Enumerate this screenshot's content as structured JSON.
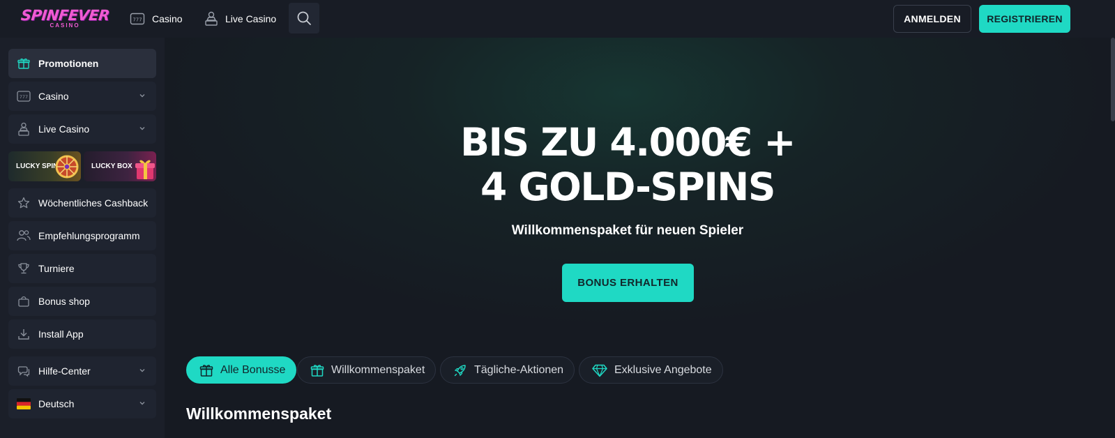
{
  "header": {
    "logo_line1": "SPINFEVER",
    "logo_line2": "CASINO",
    "nav": [
      {
        "label": "Casino",
        "icon": "slot-machine-icon"
      },
      {
        "label": "Live Casino",
        "icon": "dealer-icon"
      }
    ],
    "search_icon": "search-icon",
    "login_label": "ANMELDEN",
    "register_label": "REGISTRIEREN"
  },
  "sidebar": {
    "items": [
      {
        "label": "Promotionen",
        "icon": "gift-icon",
        "active": true
      },
      {
        "label": "Casino",
        "icon": "slot-machine-icon",
        "expandable": true
      },
      {
        "label": "Live Casino",
        "icon": "dealer-icon",
        "expandable": true
      },
      {
        "label": "Wöchentliches Cashback",
        "icon": "star-icon"
      },
      {
        "label": "Empfehlungsprogramm",
        "icon": "users-icon"
      },
      {
        "label": "Turniere",
        "icon": "trophy-icon"
      },
      {
        "label": "Bonus shop",
        "icon": "shopping-bag-icon"
      },
      {
        "label": "Install App",
        "icon": "download-icon"
      },
      {
        "label": "Hilfe-Center",
        "icon": "chat-icon",
        "expandable": true
      },
      {
        "label": "Deutsch",
        "icon": "german-flag-icon",
        "expandable": true
      }
    ],
    "tiles": [
      {
        "label": "LUCKY SPIN"
      },
      {
        "label": "LUCKY BOX"
      }
    ]
  },
  "hero": {
    "title_line1": "BIS ZU 4.000€ +",
    "title_line2": "4 GOLD-SPINS",
    "subtitle": "Willkommenspaket für neuen Spieler",
    "cta": "BONUS ERHALTEN"
  },
  "filters": [
    {
      "label": "Alle Bonusse",
      "icon": "gift-icon",
      "active": true
    },
    {
      "label": "Willkommenspaket",
      "icon": "gift-box-icon",
      "active": false
    },
    {
      "label": "Tägliche-Aktionen",
      "icon": "rocket-icon",
      "active": false
    },
    {
      "label": "Exklusive Angebote",
      "icon": "diamond-icon",
      "active": false
    }
  ],
  "section_title": "Willkommenspaket",
  "colors": {
    "accent": "#1fd9c4",
    "brand_pink": "#f05bd3",
    "background": "#171b24",
    "sidebar": "#1b1f29"
  }
}
